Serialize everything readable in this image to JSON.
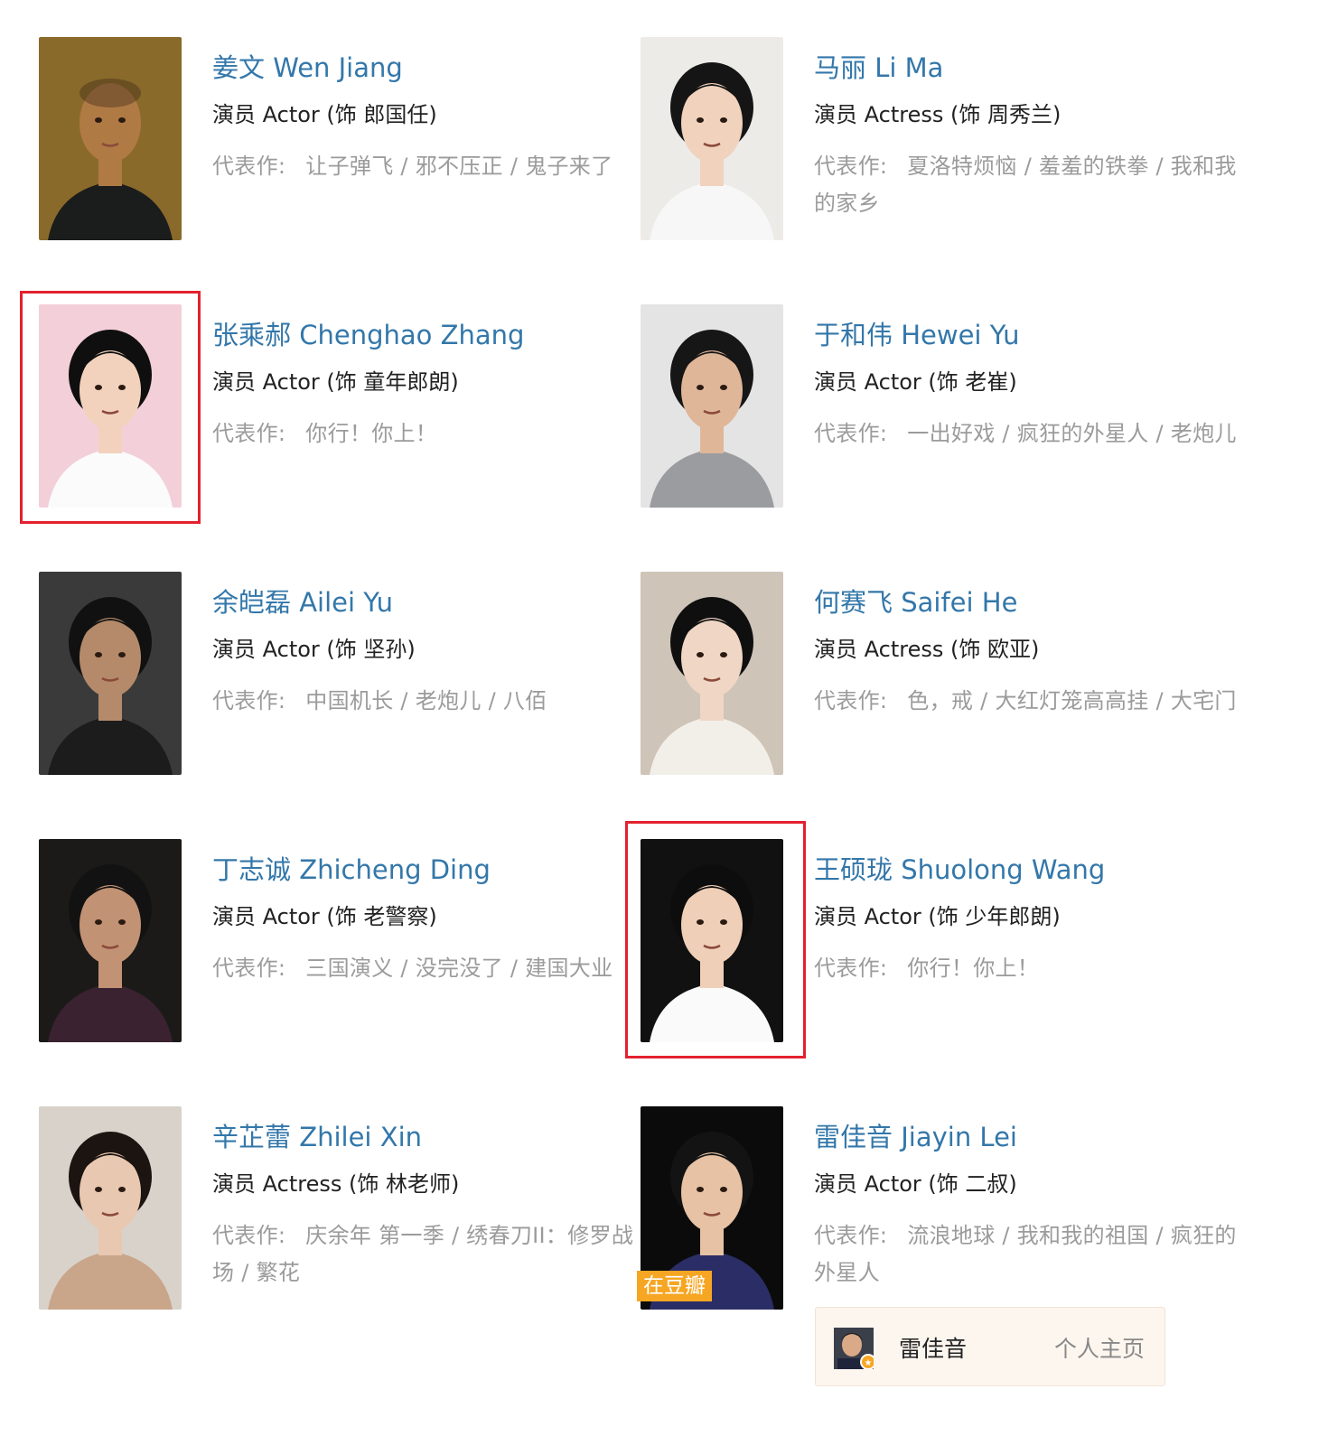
{
  "works_label": "代表作:",
  "cast": [
    {
      "name": "姜文 Wen Jiang",
      "role": "演员 Actor (饰 郎国任)",
      "works": [
        "让子弹飞",
        "邪不压正",
        "鬼子来了"
      ]
    },
    {
      "name": "马丽 Li Ma",
      "role": "演员 Actress (饰 周秀兰)",
      "works": [
        "夏洛特烦恼",
        "羞羞的铁拳",
        "我和我的家乡"
      ]
    },
    {
      "name": "张乘郝 Chenghao Zhang",
      "role": "演员 Actor (饰 童年郎朗)",
      "works": [
        "你行！你上！"
      ]
    },
    {
      "name": "于和伟 Hewei Yu",
      "role": "演员 Actor (饰 老崔)",
      "works": [
        "一出好戏",
        "疯狂的外星人",
        "老炮儿"
      ]
    },
    {
      "name": "余皑磊 Ailei Yu",
      "role": "演员 Actor (饰 坚孙)",
      "works": [
        "中国机长",
        "老炮儿",
        "八佰"
      ]
    },
    {
      "name": "何赛飞 Saifei He",
      "role": "演员 Actress (饰 欧亚)",
      "works": [
        "色，戒",
        "大红灯笼高高挂",
        "大宅门"
      ]
    },
    {
      "name": "丁志诚 Zhicheng Ding",
      "role": "演员 Actor (饰 老警察)",
      "works": [
        "三国演义",
        "没完没了",
        "建国大业"
      ]
    },
    {
      "name": "王硕珑 Shuolong Wang",
      "role": "演员 Actor (饰 少年郎朗)",
      "works": [
        "你行！你上！"
      ]
    },
    {
      "name": "辛芷蕾 Zhilei Xin",
      "role": "演员 Actress (饰 林老师)",
      "works": [
        "庆余年 第一季",
        "绣春刀II：修罗战场",
        "繁花"
      ]
    },
    {
      "name": "雷佳音 Jiayin Lei",
      "role": "演员 Actor (饰 二叔)",
      "works": [
        "流浪地球",
        "我和我的祖国",
        "疯狂的外星人"
      ]
    }
  ],
  "badge": "在豆瓣",
  "popup": {
    "name": "雷佳音",
    "link": "个人主页"
  },
  "highlight_color": "#e3212e",
  "link_color": "#3377aa"
}
